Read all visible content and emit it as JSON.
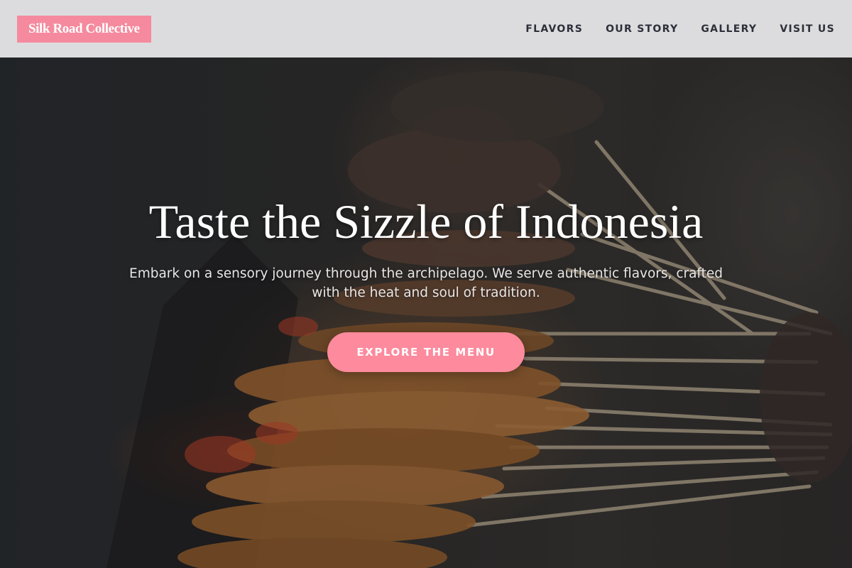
{
  "header": {
    "logo_text": "Silk Road Collective",
    "nav": [
      {
        "label": "FLAVORS"
      },
      {
        "label": "OUR STORY"
      },
      {
        "label": "GALLERY"
      },
      {
        "label": "VISIT US"
      }
    ]
  },
  "hero": {
    "title": "Taste the Sizzle of Indonesia",
    "subtitle": "Embark on a sensory journey through the archipelago. We serve authentic flavors, crafted with the heat and soul of tradition.",
    "cta_label": "EXPLORE THE MENU",
    "image_subject": "satay skewers grilling over charcoal"
  },
  "colors": {
    "accent": "#fd8a9d",
    "logo_bg": "#f58a9e",
    "header_bg": "#e4e4e6",
    "nav_text": "#2d2f3a"
  }
}
